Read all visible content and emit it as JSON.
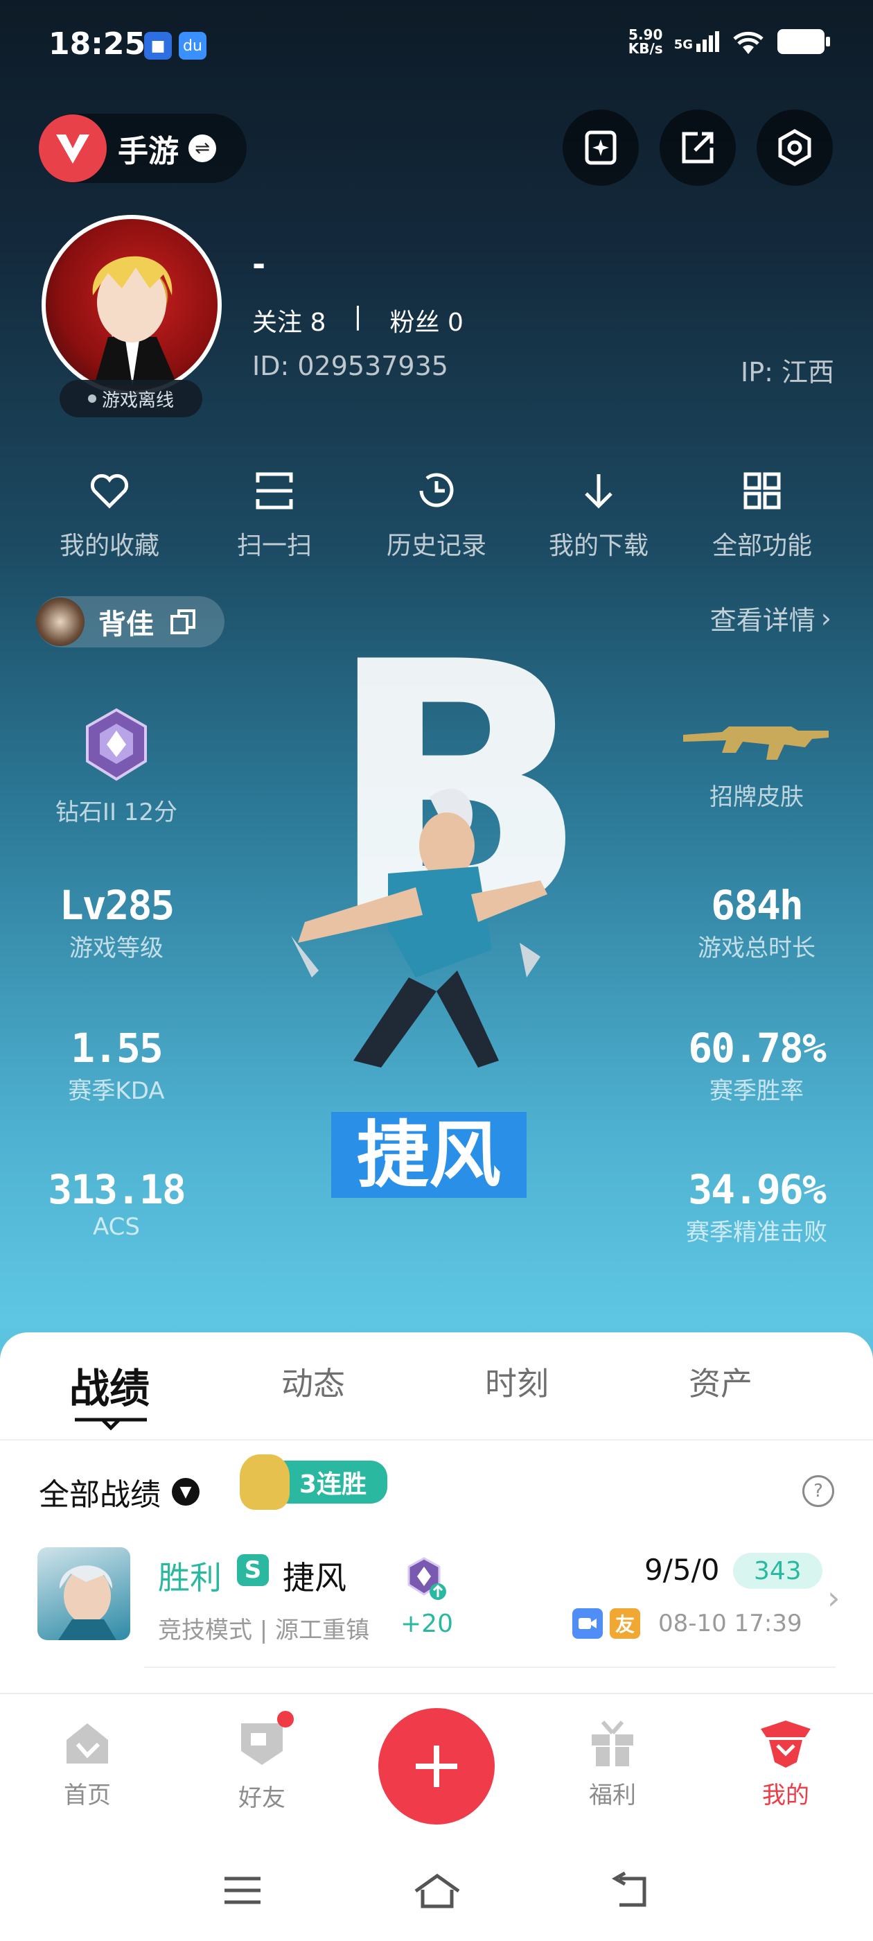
{
  "status_bar": {
    "time": "18:25",
    "speed_top": "5.90",
    "speed_bottom": "KB/s",
    "network": "5G"
  },
  "header": {
    "mode_label": "手游"
  },
  "profile": {
    "name": "-",
    "follow": "关注 8",
    "fans": "粉丝 0",
    "separator": "|",
    "id": "ID:  029537935",
    "ip": "IP:  江西",
    "status": "游戏离线"
  },
  "quick_nav": [
    {
      "label": "我的收藏",
      "icon": "heart-icon"
    },
    {
      "label": "扫一扫",
      "icon": "scan-icon"
    },
    {
      "label": "历史记录",
      "icon": "history-icon"
    },
    {
      "label": "我的下载",
      "icon": "download-icon"
    },
    {
      "label": "全部功能",
      "icon": "grid-icon"
    }
  ],
  "game_card": {
    "player_name": "背佳",
    "view_details": "查看详情",
    "rank_label": "钻石II 12分",
    "skin_label": "招牌皮肤",
    "agent_name": "捷风",
    "stats_left": [
      {
        "value": "Lv285",
        "label": "游戏等级"
      },
      {
        "value": "1.55",
        "label": "赛季KDA"
      },
      {
        "value": "313.18",
        "label": "ACS"
      }
    ],
    "stats_right": [
      {
        "value": "684h",
        "label": "游戏总时长"
      },
      {
        "value": "60.78%",
        "label": "赛季胜率"
      },
      {
        "value": "34.96%",
        "label": "赛季精准击败"
      }
    ]
  },
  "tabs": [
    {
      "label": "战绩",
      "active": true
    },
    {
      "label": "动态"
    },
    {
      "label": "时刻"
    },
    {
      "label": "资产"
    }
  ],
  "records": {
    "filter_label": "全部战绩",
    "streak_label": "3连胜",
    "match": {
      "result": "胜利",
      "role_letter": "S",
      "agent": "捷风",
      "mode": "竞技模式 | 源工重镇",
      "rank_change": "+20",
      "kda": "9/5/0",
      "acs": "343",
      "tag": "友",
      "time": "08-10 17:39"
    }
  },
  "bottom_nav": [
    {
      "label": "首页",
      "icon": "home-icon"
    },
    {
      "label": "好友",
      "icon": "friends-icon"
    },
    {
      "label": "",
      "icon": "plus-icon"
    },
    {
      "label": "福利",
      "icon": "gift-icon"
    },
    {
      "label": "我的",
      "icon": "profile-icon",
      "active": true
    }
  ],
  "colors": {
    "accent_red": "#e8414a",
    "win_teal": "#2bb8a0",
    "acs_bg": "#d9f5ef"
  }
}
